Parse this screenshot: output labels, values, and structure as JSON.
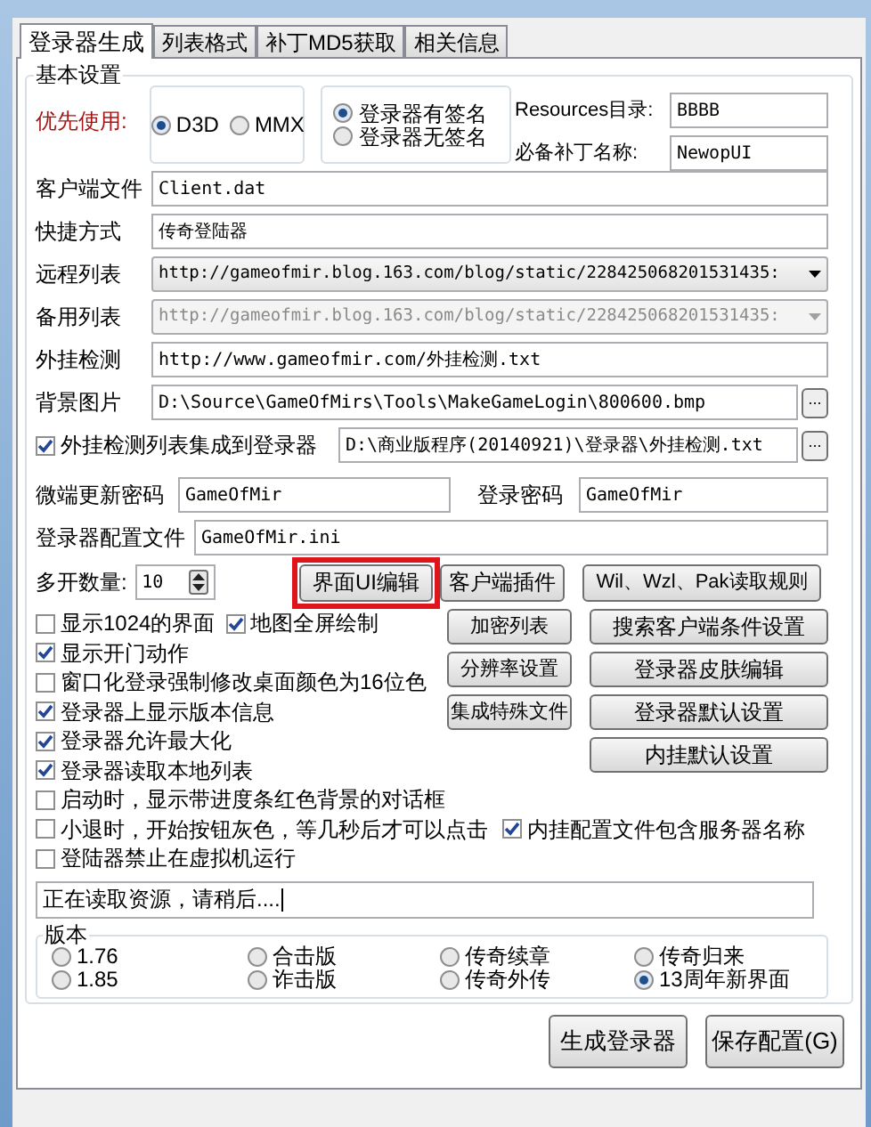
{
  "tabs": [
    {
      "label": "登录器生成",
      "selected": true
    },
    {
      "label": "列表格式",
      "selected": false
    },
    {
      "label": "补丁MD5获取",
      "selected": false
    },
    {
      "label": "相关信息",
      "selected": false
    }
  ],
  "basic_settings": {
    "title": "基本设置",
    "priority_label": "优先使用:",
    "render_modes": [
      {
        "label": "D3D",
        "selected": true
      },
      {
        "label": "MMX",
        "selected": false
      }
    ],
    "signature_modes": [
      {
        "label": "登录器有签名",
        "selected": true
      },
      {
        "label": "登录器无签名",
        "selected": false
      }
    ],
    "resources_dir": {
      "label": "Resources目录:",
      "value": "BBBB"
    },
    "required_patch": {
      "label": "必备补丁名称:",
      "value": "NewopUI"
    },
    "fields": [
      {
        "kind": "text",
        "label": "客户端文件",
        "value": "Client.dat"
      },
      {
        "kind": "text",
        "label": "快捷方式",
        "value": "传奇登陆器"
      },
      {
        "kind": "combo",
        "label": "远程列表",
        "value": "http://gameofmir.blog.163.com/blog/static/228425068201531435:",
        "disabled": false
      },
      {
        "kind": "combo",
        "label": "备用列表",
        "value": "http://gameofmir.blog.163.com/blog/static/228425068201531435:",
        "disabled": true
      },
      {
        "kind": "text",
        "label": "外挂检测",
        "value": "http://www.gameofmir.com/外挂检测.txt"
      },
      {
        "kind": "browse",
        "label": "背景图片",
        "value": "D:\\Source\\GameOfMirs\\Tools\\MakeGameLogin\\800600.bmp",
        "button": "..."
      },
      {
        "kind": "check_browse",
        "label": "外挂检测列表集成到登录器",
        "checked": true,
        "value": "D:\\商业版程序(20140921)\\登录器\\外挂检测.txt",
        "button": "..."
      }
    ],
    "update_password": {
      "label": "微端更新密码",
      "value": "GameOfMir"
    },
    "login_password": {
      "label": "登录密码",
      "value": "GameOfMir"
    },
    "config_file": {
      "label": "登录器配置文件",
      "value": "GameOfMir.ini"
    },
    "instance_count": {
      "label": "多开数量:",
      "value": "10"
    },
    "top_buttons": [
      {
        "label": "界面UI编辑",
        "highlighted": true
      },
      {
        "label": "客户端插件",
        "highlighted": false
      },
      {
        "label": "Wil、Wzl、Pak读取规则",
        "highlighted": false
      }
    ],
    "narrow_buttons": [
      "加密列表",
      "分辨率设置",
      "集成特殊文件"
    ],
    "wide_buttons": [
      "搜索客户端条件设置",
      "登录器皮肤编辑",
      "登录器默认设置",
      "内挂默认设置"
    ],
    "side_options": [
      [
        {
          "label": "显示1024的界面",
          "checked": false
        },
        {
          "label": "地图全屏绘制",
          "checked": true
        }
      ],
      [
        {
          "label": "显示开门动作",
          "checked": true
        }
      ],
      [
        {
          "label": "窗口化登录强制修改桌面颜色为16位色",
          "checked": false
        }
      ],
      [
        {
          "label": "登录器上显示版本信息",
          "checked": true
        }
      ],
      [
        {
          "label": "登录器允许最大化",
          "checked": true
        }
      ],
      [
        {
          "label": "登录器读取本地列表",
          "checked": true
        }
      ]
    ],
    "options": [
      [
        {
          "label": "启动时，显示带进度条红色背景的对话框",
          "checked": false
        }
      ],
      [
        {
          "label": "小退时，开始按钮灰色，等几秒后才可以点击",
          "checked": false
        },
        {
          "label": "内挂配置文件包含服务器名称",
          "checked": true
        }
      ],
      [
        {
          "label": "登陆器禁止在虚拟机运行",
          "checked": false
        }
      ]
    ],
    "status": "正在读取资源，请稍后....",
    "versions": {
      "title": "版本",
      "items": [
        {
          "label": "1.76",
          "selected": false
        },
        {
          "label": "合击版",
          "selected": false
        },
        {
          "label": "传奇续章",
          "selected": false
        },
        {
          "label": "传奇归来",
          "selected": false
        },
        {
          "label": "1.85",
          "selected": false
        },
        {
          "label": "诈击版",
          "selected": false
        },
        {
          "label": "传奇外传",
          "selected": false
        },
        {
          "label": "13周年新界面",
          "selected": true
        }
      ]
    }
  },
  "actions": [
    "生成登录器",
    "保存配置(G)"
  ]
}
